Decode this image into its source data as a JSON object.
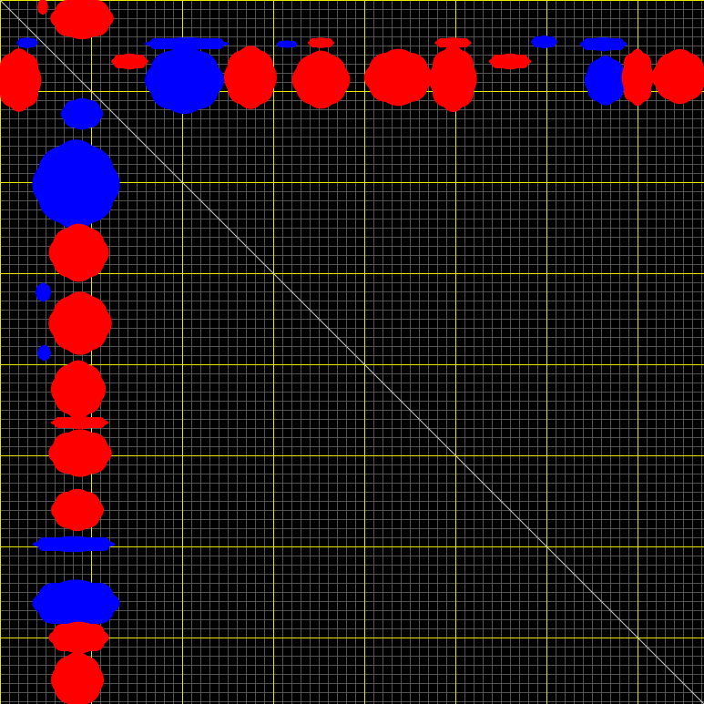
{
  "chart_data": {
    "type": "heatmap",
    "title": "",
    "xlabel": "",
    "ylabel": "",
    "n": 773,
    "grid": {
      "minor_step": 10,
      "major_step": 100
    },
    "diagonal": true,
    "legend": "none",
    "colors": {
      "background": "#000000",
      "minor_grid": "#6e6e6e",
      "major_grid": "#e8e800",
      "diagonal": "#c8c8c8",
      "positive": "#ff0000",
      "negative": "#0000ff"
    },
    "blobs": [
      {
        "sign": "pos",
        "r": [
          0,
          40
        ],
        "c": [
          60,
          120
        ]
      },
      {
        "sign": "pos",
        "r": [
          58,
          118
        ],
        "c": [
          0,
          42
        ]
      },
      {
        "sign": "neg",
        "r": [
          42,
          54
        ],
        "c": [
          165,
          245
        ]
      },
      {
        "sign": "neg",
        "r": [
          56,
          120
        ],
        "c": [
          165,
          240
        ]
      },
      {
        "sign": "pos",
        "r": [
          55,
          115
        ],
        "c": [
          250,
          300
        ]
      },
      {
        "sign": "pos",
        "r": [
          60,
          115
        ],
        "c": [
          325,
          380
        ]
      },
      {
        "sign": "pos",
        "r": [
          58,
          112
        ],
        "c": [
          405,
          470
        ]
      },
      {
        "sign": "pos",
        "r": [
          55,
          118
        ],
        "c": [
          475,
          520
        ]
      },
      {
        "sign": "pos",
        "r": [
          60,
          75
        ],
        "c": [
          540,
          580
        ]
      },
      {
        "sign": "neg",
        "r": [
          42,
          55
        ],
        "c": [
          640,
          685
        ]
      },
      {
        "sign": "neg",
        "r": [
          65,
          112
        ],
        "c": [
          645,
          685
        ]
      },
      {
        "sign": "pos",
        "r": [
          58,
          112
        ],
        "c": [
          685,
          715
        ]
      },
      {
        "sign": "pos",
        "r": [
          58,
          110
        ],
        "c": [
          720,
          773
        ]
      },
      {
        "sign": "neg",
        "r": [
          42,
          52
        ],
        "c": [
          20,
          40
        ]
      },
      {
        "sign": "neg",
        "r": [
          45,
          52
        ],
        "c": [
          305,
          325
        ]
      },
      {
        "sign": "pos",
        "r": [
          42,
          52
        ],
        "c": [
          340,
          365
        ]
      },
      {
        "sign": "neg",
        "r": [
          40,
          52
        ],
        "c": [
          585,
          610
        ]
      },
      {
        "sign": "pos",
        "r": [
          42,
          52
        ],
        "c": [
          480,
          515
        ]
      },
      {
        "sign": "pos",
        "r": [
          60,
          75
        ],
        "c": [
          125,
          160
        ]
      },
      {
        "sign": "neg",
        "r": [
          110,
          140
        ],
        "c": [
          70,
          110
        ]
      },
      {
        "sign": "neg",
        "r": [
          160,
          245
        ],
        "c": [
          42,
          125
        ]
      },
      {
        "sign": "pos",
        "r": [
          250,
          305
        ],
        "c": [
          58,
          115
        ]
      },
      {
        "sign": "neg",
        "r": [
          312,
          330
        ],
        "c": [
          40,
          55
        ]
      },
      {
        "sign": "pos",
        "r": [
          325,
          385
        ],
        "c": [
          58,
          118
        ]
      },
      {
        "sign": "pos",
        "r": [
          400,
          455
        ],
        "c": [
          60,
          112
        ]
      },
      {
        "sign": "pos",
        "r": [
          458,
          470
        ],
        "c": [
          60,
          115
        ]
      },
      {
        "sign": "pos",
        "r": [
          475,
          520
        ],
        "c": [
          58,
          118
        ]
      },
      {
        "sign": "pos",
        "r": [
          540,
          580
        ],
        "c": [
          60,
          110
        ]
      },
      {
        "sign": "neg",
        "r": [
          590,
          605
        ],
        "c": [
          42,
          120
        ]
      },
      {
        "sign": "neg",
        "r": [
          640,
          685
        ],
        "c": [
          42,
          125
        ]
      },
      {
        "sign": "pos",
        "r": [
          685,
          715
        ],
        "c": [
          58,
          115
        ]
      },
      {
        "sign": "pos",
        "r": [
          720,
          773
        ],
        "c": [
          60,
          110
        ]
      },
      {
        "sign": "neg",
        "r": [
          380,
          395
        ],
        "c": [
          42,
          55
        ]
      },
      {
        "sign": "pos",
        "r": [
          0,
          15
        ],
        "c": [
          42,
          52
        ]
      }
    ]
  }
}
